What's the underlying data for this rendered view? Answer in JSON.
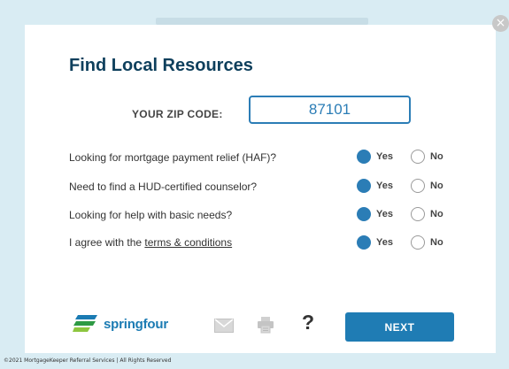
{
  "modal": {
    "title": "Find Local Resources",
    "close_glyph": "×",
    "zip": {
      "label": "YOUR ZIP CODE:",
      "value": "87101"
    },
    "questions": [
      {
        "text": "Looking for mortgage payment relief (HAF)?",
        "answer": "Yes"
      },
      {
        "text": "Need to find a HUD-certified counselor?",
        "answer": "Yes"
      },
      {
        "text": "Looking for help with basic needs?",
        "answer": "Yes"
      },
      {
        "text_prefix": "I agree with the ",
        "link_text": "terms & conditions",
        "answer": "Yes"
      }
    ],
    "options": {
      "yes": "Yes",
      "no": "No"
    },
    "footer": {
      "logo_text": "springfour",
      "help_glyph": "?",
      "next_label": "NEXT",
      "icons": [
        "email-icon",
        "print-icon",
        "help-icon"
      ]
    }
  },
  "copyright": "©2021 MortgageKeeper Referral Services | All Rights Reserved",
  "colors": {
    "accent": "#2b7db6",
    "title": "#0e3f5c",
    "background": "#d9ecf3",
    "next_button": "#1f7cb4"
  }
}
